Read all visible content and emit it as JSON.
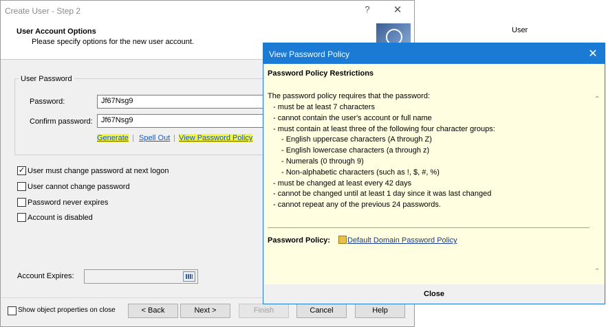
{
  "background_window": {
    "column_header": "User"
  },
  "dialog": {
    "title": "Create User - Step 2",
    "help_glyph": "?",
    "close_glyph": "✕",
    "header_title": "User Account Options",
    "header_subtitle": "Please specify options for the new user account.",
    "header_icon": "user-account-icon",
    "group_title": "User Password",
    "password_label": "Password:",
    "password_value": "Jf67Nsg9",
    "confirm_label": "Confirm password:",
    "confirm_value": "Jf67Nsg9",
    "links": {
      "generate": "Generate",
      "spell_out": "Spell Out",
      "view_policy": "View Password Policy",
      "separator": "|"
    },
    "checkboxes": [
      {
        "label": "User must change password at next logon",
        "checked": true
      },
      {
        "label": "User cannot change password",
        "checked": false
      },
      {
        "label": "Password never expires",
        "checked": false
      },
      {
        "label": "Account is disabled",
        "checked": false
      }
    ],
    "account_expires_label": "Account Expires:",
    "show_props_label": "Show object properties on close",
    "buttons": {
      "back": "< Back",
      "next": "Next >",
      "finish": "Finish",
      "cancel": "Cancel",
      "help": "Help"
    }
  },
  "popup": {
    "title": "View Password Policy",
    "close_glyph": "✕",
    "heading": "Password Policy Restrictions",
    "intro": "The password policy requires that the password:",
    "rules": [
      {
        "text": "- must be at least 7 characters",
        "level": 1
      },
      {
        "text": "- cannot contain the user's account or full name",
        "level": 1
      },
      {
        "text": "- must contain at least three of the following four character groups:",
        "level": 1
      },
      {
        "text": "- English uppercase characters (A through Z)",
        "level": 2
      },
      {
        "text": "- English lowercase characters (a through z)",
        "level": 2
      },
      {
        "text": "- Numerals (0 through 9)",
        "level": 2
      },
      {
        "text": "- Non-alphabetic characters (such as !, $, #, %)",
        "level": 2
      },
      {
        "text": "- must be changed at least every 42 days",
        "level": 1
      },
      {
        "text": "- cannot be changed until at least 1 day since it was last changed",
        "level": 1
      },
      {
        "text": "- cannot repeat any of the previous 24 passwords.",
        "level": 1
      }
    ],
    "policy_label": "Password Policy:",
    "policy_link": "Default Domain Password Policy",
    "scroll_up_glyph": "⌃",
    "scroll_down_glyph": "⌄",
    "close_button": "Close"
  }
}
